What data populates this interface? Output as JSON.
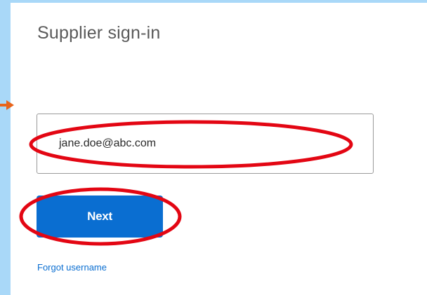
{
  "page": {
    "title": "Supplier sign-in"
  },
  "login_form": {
    "username_value": "jane.doe@abc.com",
    "next_label": "Next",
    "forgot_username_label": "Forgot username"
  },
  "colors": {
    "page_background": "#ffffff",
    "side_band": "#a9d8f8",
    "primary_button": "#0a6ed1",
    "link": "#0a6ed1",
    "title_text": "#5a5a5a",
    "annotation_red": "#e30613",
    "arrow_orange": "#e8641b"
  },
  "annotations": {
    "icons": [
      "pointer-arrow-icon",
      "highlight-ellipse-username",
      "highlight-ellipse-next"
    ]
  }
}
